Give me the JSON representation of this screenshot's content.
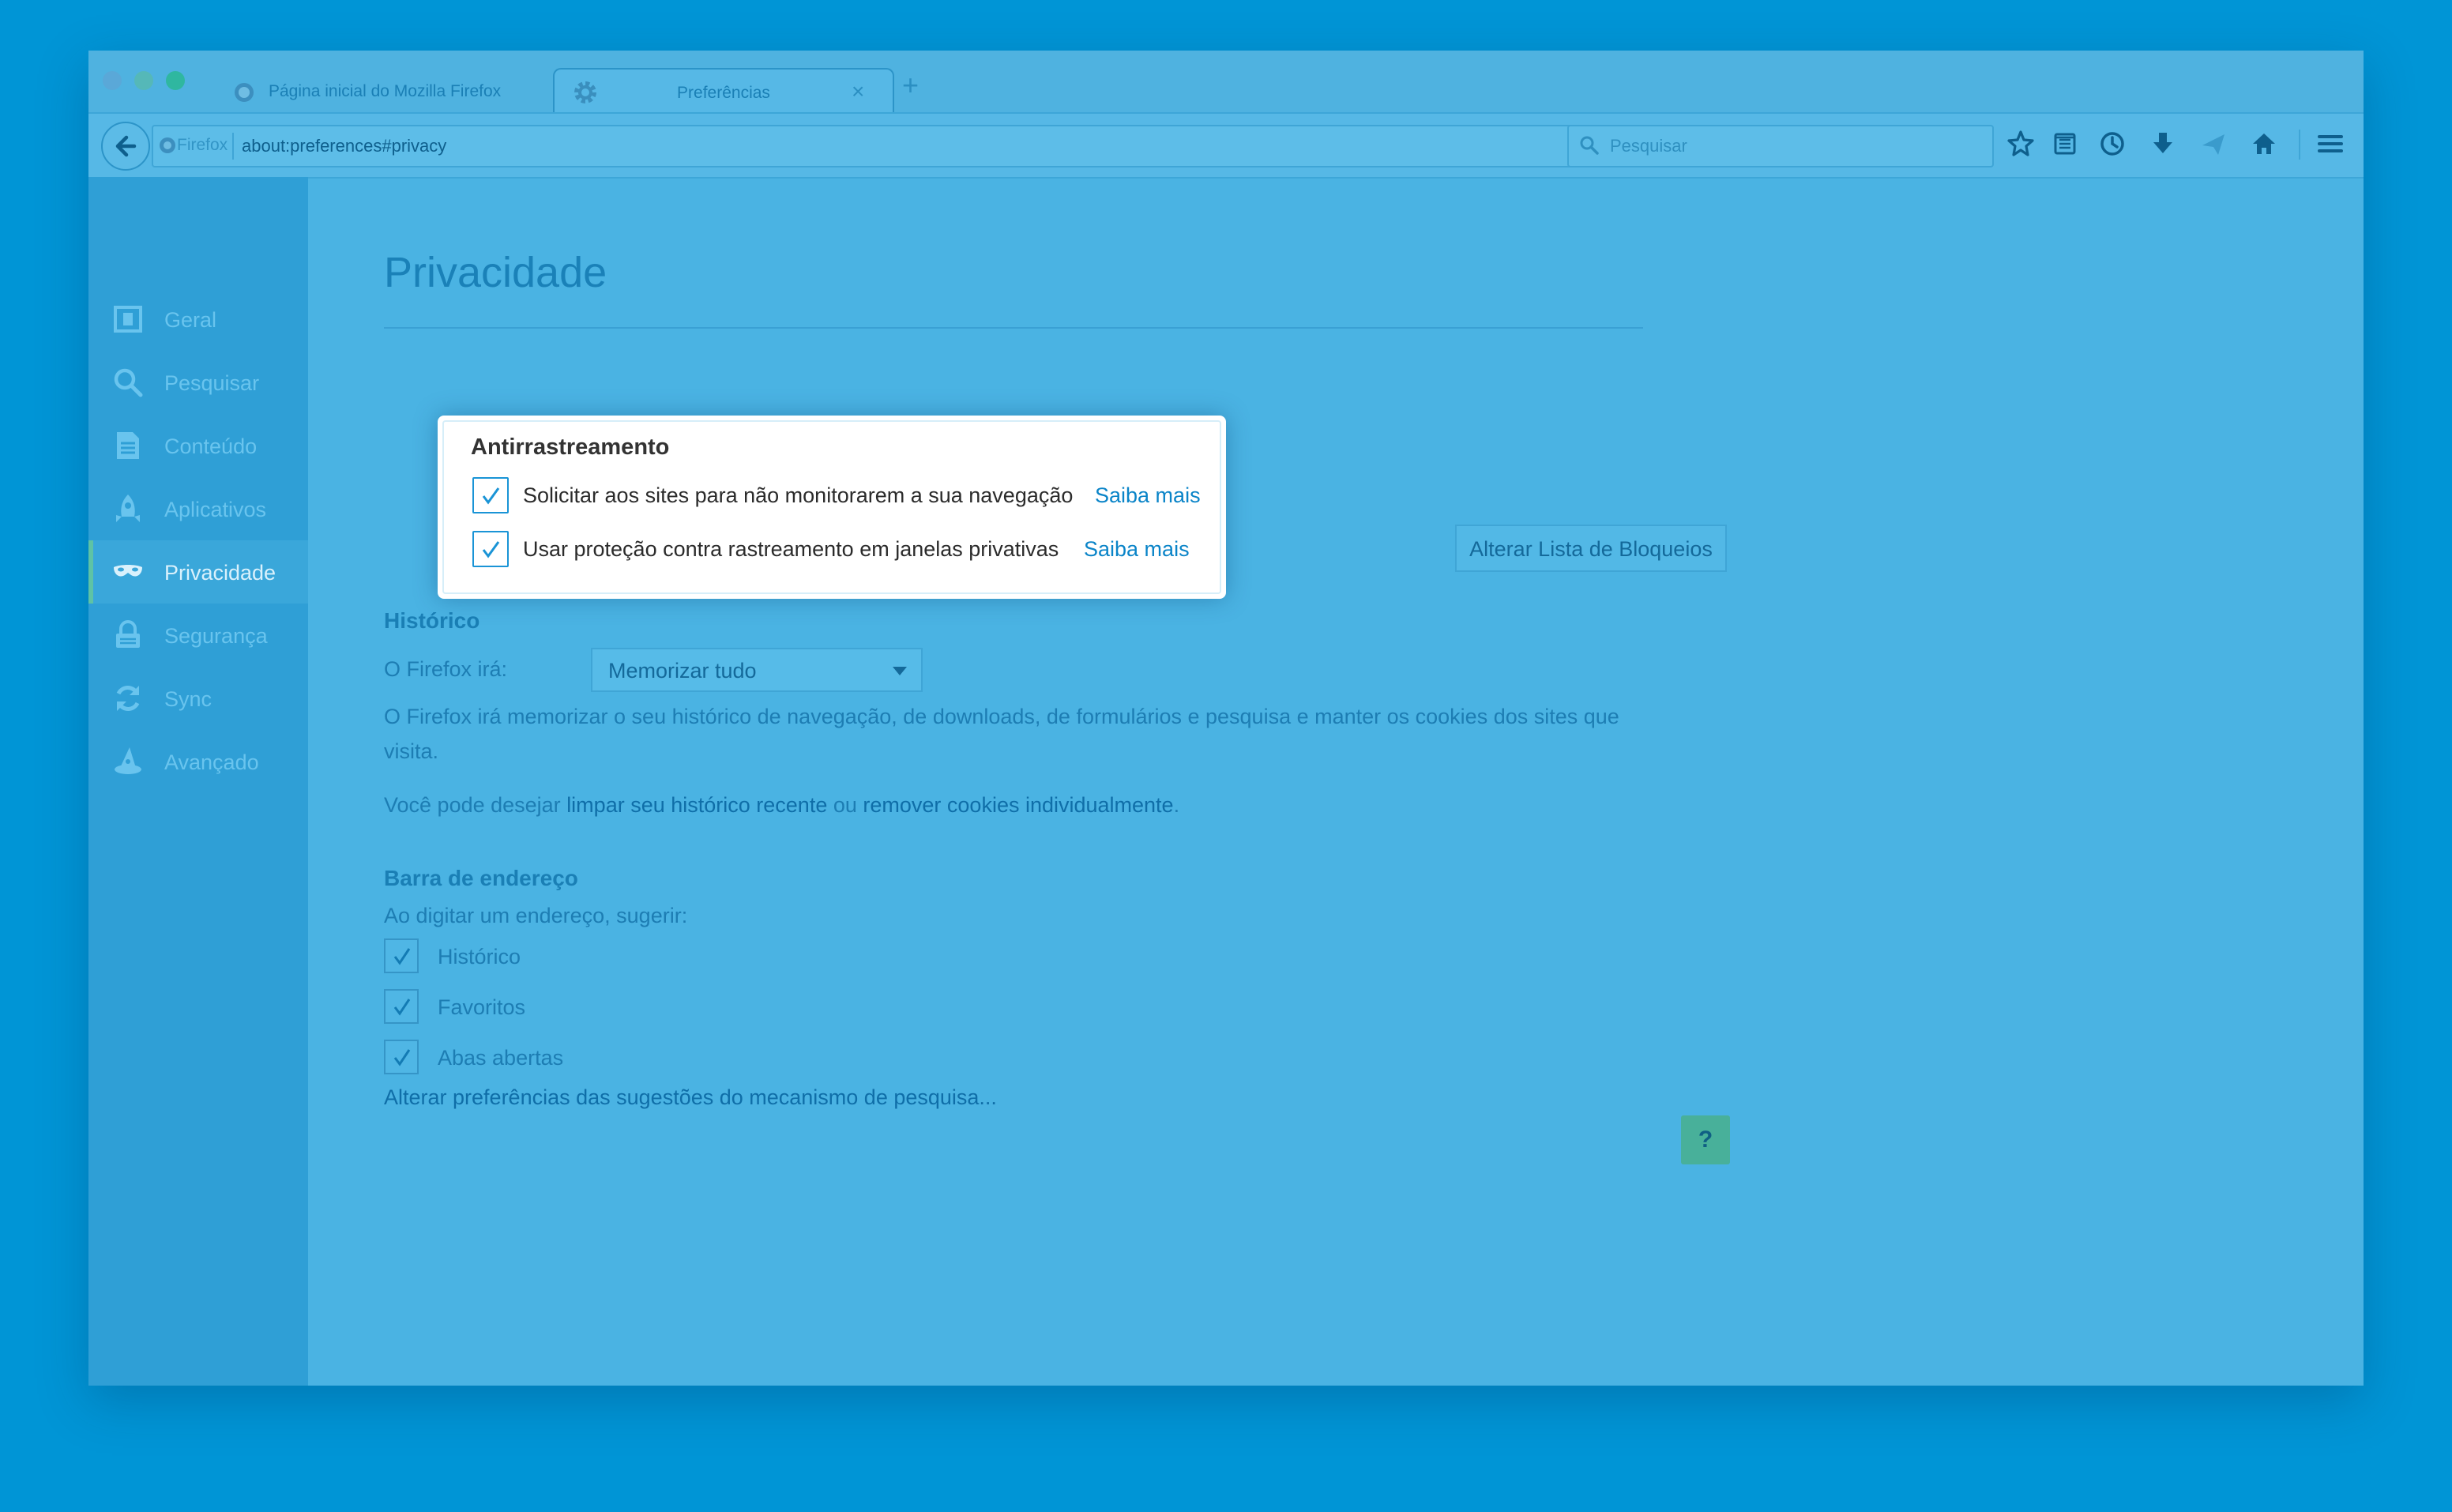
{
  "browser": {
    "traffic_colors": [
      "#5aa8d8",
      "#55b8b8",
      "#2fb7a0"
    ],
    "tabs": [
      {
        "title": "Página inicial do Mozilla Firefox",
        "close": "×",
        "icon": "firefox-globe-icon"
      },
      {
        "title": "Preferências",
        "close": "×",
        "icon": "gear-icon",
        "active": true
      }
    ],
    "new_tab": "+",
    "url_identity": "Firefox",
    "url": "about:preferences#privacy",
    "search_placeholder": "Pesquisar",
    "toolbar_icons": [
      "star-icon",
      "reading-list-icon",
      "pocket-icon",
      "download-icon",
      "send-icon",
      "home-icon",
      "menu-icon"
    ]
  },
  "sidebar": {
    "items": [
      {
        "label": "Geral",
        "icon": "general-icon"
      },
      {
        "label": "Pesquisar",
        "icon": "search-icon"
      },
      {
        "label": "Conteúdo",
        "icon": "content-icon"
      },
      {
        "label": "Aplicativos",
        "icon": "rocket-icon"
      },
      {
        "label": "Privacidade",
        "icon": "mask-icon",
        "active": true
      },
      {
        "label": "Segurança",
        "icon": "lock-icon"
      },
      {
        "label": "Sync",
        "icon": "sync-icon"
      },
      {
        "label": "Avançado",
        "icon": "wizard-hat-icon"
      }
    ]
  },
  "main": {
    "title": "Privacidade",
    "tracking": {
      "heading": "Antirrastreamento",
      "options": [
        {
          "label": "Solicitar aos sites para não monitorarem a sua navegação",
          "link": "Saiba mais",
          "checked": true
        },
        {
          "label": "Usar proteção contra rastreamento em janelas privativas",
          "link": "Saiba mais",
          "checked": true
        }
      ],
      "block_list_button": "Alterar Lista de Bloqueios"
    },
    "history": {
      "heading": "Histórico",
      "firefox_will_label": "O Firefox irá:",
      "select_value": "Memorizar tudo",
      "description_line1": "O Firefox irá memorizar o seu histórico de navegação, de downloads, de formulários e pesquisa e manter os cookies dos sites que",
      "description_line2": "visita.",
      "clear_prefix": "Você pode desejar ",
      "clear_link": "limpar seu histórico recente",
      "clear_middle": " ou ",
      "cookies_link": "remover cookies individualmente",
      "clear_suffix": "."
    },
    "address_bar": {
      "heading": "Barra de endereço",
      "subtitle": "Ao digitar um endereço, sugerir:",
      "options": [
        {
          "label": "Histórico",
          "checked": true
        },
        {
          "label": "Favoritos",
          "checked": true
        },
        {
          "label": "Abas abertas",
          "checked": true
        }
      ],
      "search_suggestions_link": "Alterar preferências das sugestões do mecanismo de pesquisa..."
    },
    "help_button": "?"
  }
}
